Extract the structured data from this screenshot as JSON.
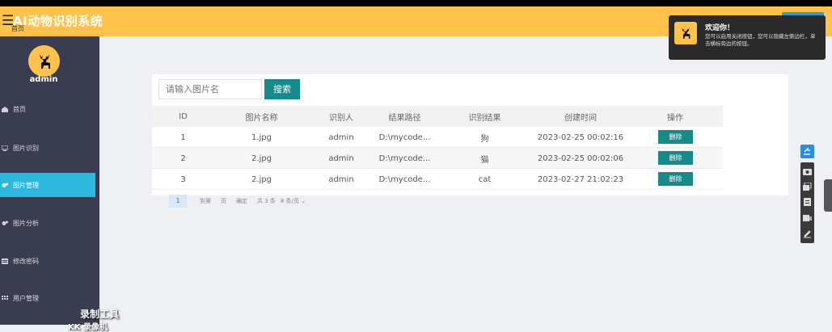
{
  "header": {
    "menu_icon": "menu-icon",
    "title": "AI动物识别系统",
    "home_link": "首页"
  },
  "sidebar": {
    "avatar_icon": "deer-icon",
    "user": "admin",
    "items": [
      {
        "label": "首页",
        "icon": "home-icon"
      },
      {
        "label": "图片识别",
        "icon": "monitor-icon"
      },
      {
        "label": "图片管理",
        "icon": "settings-icon",
        "active": true
      },
      {
        "label": "图片分析",
        "icon": "settings-icon"
      },
      {
        "label": "修改密码",
        "icon": "list-icon"
      },
      {
        "label": "用户管理",
        "icon": "grid-icon"
      }
    ]
  },
  "search": {
    "placeholder": "请输入图片名",
    "button": "搜索"
  },
  "table": {
    "columns": [
      "ID",
      "图片名称",
      "识别人",
      "结果路径",
      "识别结果",
      "创建时间",
      "操作"
    ],
    "rows": [
      {
        "id": "1",
        "name": "1.jpg",
        "user": "admin",
        "path": "D:\\mycode...",
        "result": "狗",
        "created": "2023-02-25 00:02:16",
        "action": "删除"
      },
      {
        "id": "2",
        "name": "2.jpg",
        "user": "admin",
        "path": "D:\\mycode...",
        "result": "猫",
        "created": "2023-02-25 00:02:06",
        "action": "删除"
      },
      {
        "id": "3",
        "name": "2.jpg",
        "user": "admin",
        "path": "D:\\mycode...",
        "result": "cat",
        "created": "2023-02-27 21:02:23",
        "action": "删除"
      }
    ]
  },
  "pager": {
    "current": "1",
    "goto": "到第",
    "page": "页",
    "confirm": "确定",
    "total": "共 3 条",
    "per_page": "8 条/页"
  },
  "toast": {
    "icon": "deer-icon",
    "title": "欢迎你！",
    "message": "您可以启用关闭按钮，您可以隐藏左侧边栏，单击横标旁边的按钮。"
  },
  "watermark": {
    "line1": "录制工具",
    "line2": "KK 录像机"
  },
  "colors": {
    "header": "#ffc24a",
    "sidebar": "#393d4f",
    "active": "#2fb8dd",
    "primary_button": "#168a8a"
  }
}
